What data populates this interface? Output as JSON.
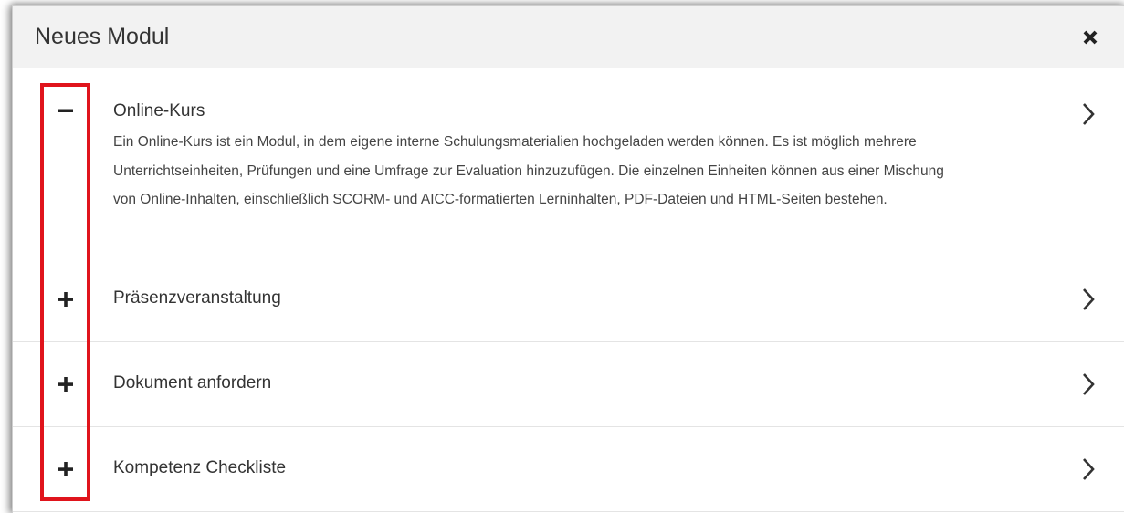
{
  "modal": {
    "title": "Neues Modul",
    "close_icon": "close-icon"
  },
  "items": [
    {
      "title": "Online-Kurs",
      "expanded": true,
      "toggle_icon": "minus-icon",
      "description": "Ein Online-Kurs ist ein Modul, in dem eigene interne Schulungsmaterialien hochgeladen werden können. Es ist möglich mehrere Unterrichtseinheiten, Prüfungen und eine Umfrage zur Evaluation hinzuzufügen. Die einzelnen Einheiten können aus einer Mischung von Online-Inhalten, einschließlich SCORM- und AICC-formatierten Lerninhalten, PDF-Dateien und HTML-Seiten bestehen.",
      "chevron_icon": "chevron-right-icon"
    },
    {
      "title": "Präsenzveranstaltung",
      "expanded": false,
      "toggle_icon": "plus-icon",
      "chevron_icon": "chevron-right-icon"
    },
    {
      "title": "Dokument anfordern",
      "expanded": false,
      "toggle_icon": "plus-icon",
      "chevron_icon": "chevron-right-icon"
    },
    {
      "title": "Kompetenz Checkliste",
      "expanded": false,
      "toggle_icon": "plus-icon",
      "chevron_icon": "chevron-right-icon"
    }
  ],
  "annotation": {
    "highlight_color": "#e0141c"
  },
  "colors": {
    "header_bg": "#f2f2f2",
    "text": "#333333",
    "divider": "#e4e4e4"
  }
}
